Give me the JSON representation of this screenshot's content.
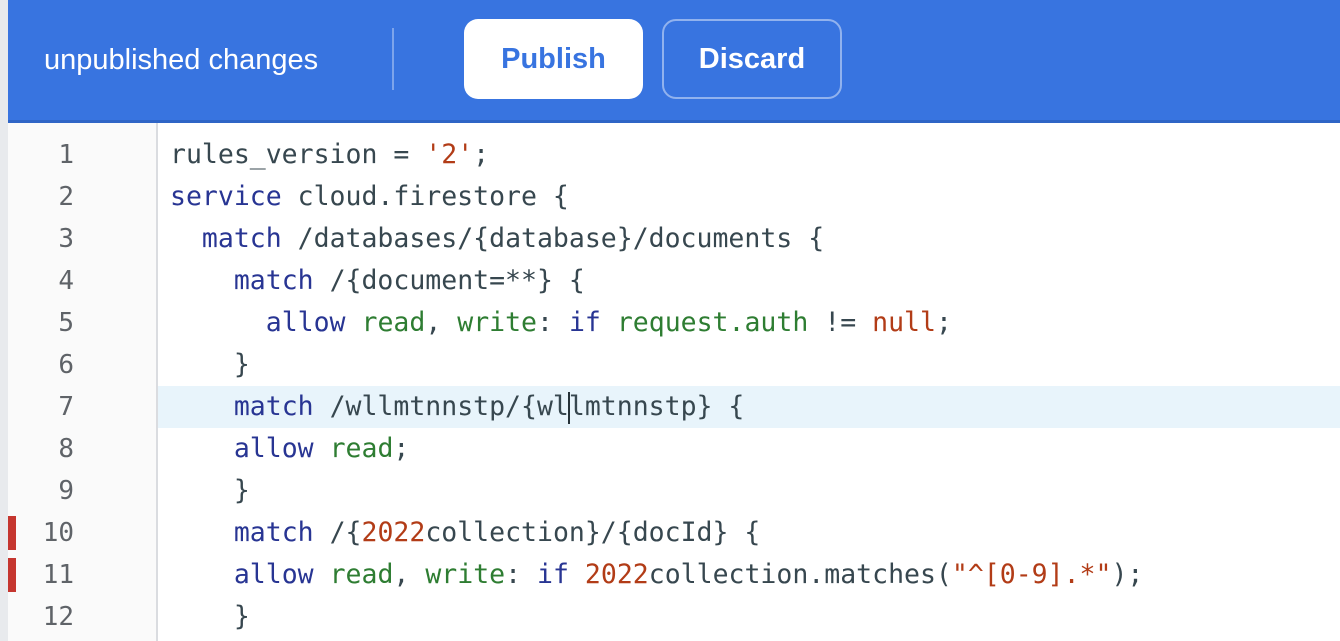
{
  "topbar": {
    "status": "unpublished changes",
    "publish_label": "Publish",
    "discard_label": "Discard",
    "background_color": "#3874e0"
  },
  "editor": {
    "active_line": 7,
    "error_lines": [
      10,
      11
    ],
    "lines": [
      {
        "number": "1",
        "text": "rules_version = '2';"
      },
      {
        "number": "2",
        "text": "service cloud.firestore {"
      },
      {
        "number": "3",
        "text": "  match /databases/{database}/documents {"
      },
      {
        "number": "4",
        "text": "    match /{document=**} {"
      },
      {
        "number": "5",
        "text": "      allow read, write: if request.auth != null;"
      },
      {
        "number": "6",
        "text": "    }"
      },
      {
        "number": "7",
        "text": "    match /wllmtnnstp/{wllmtnnstp} {"
      },
      {
        "number": "8",
        "text": "    allow read;"
      },
      {
        "number": "9",
        "text": "    }"
      },
      {
        "number": "10",
        "text": "    match /{2022collection}/{docId} {"
      },
      {
        "number": "11",
        "text": "    allow read, write: if 2022collection.matches(\"^[0-9].*\");"
      },
      {
        "number": "12",
        "text": "    }"
      }
    ]
  }
}
